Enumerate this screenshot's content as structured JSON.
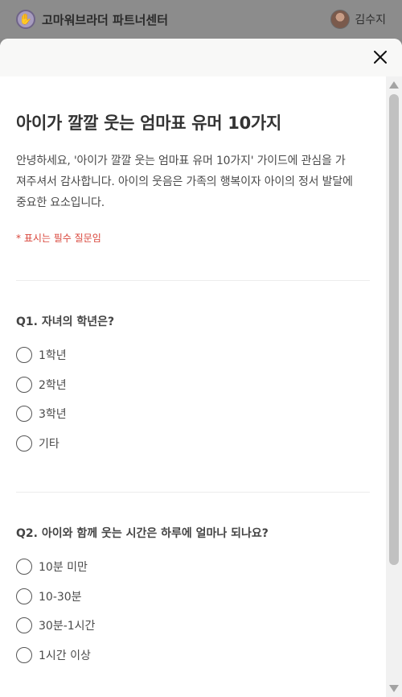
{
  "header": {
    "brand_name": "고마워브라더 파트너센터",
    "brand_logo_icon": "hand-logo-icon",
    "user_name": "김수지"
  },
  "modal": {
    "close_icon": "close-icon",
    "title": "아이가 깔깔 웃는 엄마표 유머 10가지",
    "intro": "안녕하세요, '아이가 깔깔 웃는 엄마표 유머 10가지' 가이드에 관심을 가져주셔서 감사합니다. 아이의 웃음은 가족의 행복이자 아이의 정서 발달에 중요한 요소입니다.",
    "required_note": "* 표시는 필수 질문임",
    "questions": [
      {
        "label": "Q1. 자녀의 학년은?",
        "options": [
          "1학년",
          "2학년",
          "3학년",
          "기타"
        ]
      },
      {
        "label": "Q2. 아이와 함께 웃는 시간은 하루에 얼마나 되나요?",
        "options": [
          "10분 미만",
          "10-30분",
          "30분-1시간",
          "1시간 이상"
        ]
      }
    ]
  },
  "colors": {
    "required": "#d9463b",
    "overlay": "#8c8c8c"
  }
}
